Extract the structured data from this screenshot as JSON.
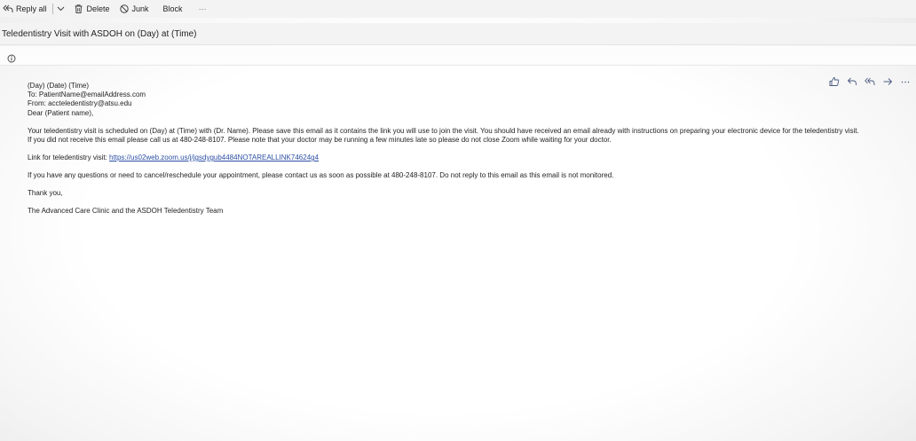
{
  "toolbar": {
    "reply_all_label": "Reply all",
    "delete_label": "Delete",
    "junk_label": "Junk",
    "block_label": "Block",
    "more_label": "···"
  },
  "subject": "Teledentistry Visit with ASDOH on (Day) at (Time)",
  "icons": {
    "reply_all": "reply-all-icon",
    "chevron": "chevron-down-icon",
    "delete": "trash-icon",
    "junk": "block-circle-icon",
    "info": "info-icon",
    "like": "thumbs-up-icon",
    "reply": "reply-icon",
    "forward": "forward-arrow-icon",
    "more": "more-dots-icon"
  },
  "email": {
    "date_line": "(Day) (Date) (Time)",
    "to_line": "To: PatientName@emailAddress.com",
    "from_line": "From: accteledentistry@atsu.edu",
    "greeting": "Dear (Patient name),",
    "para1_line1": "Your teledentistry visit is scheduled on (Day) at (Time) with (Dr. Name). Please save this email as it contains the link you will use to join the visit. You should have received an email already with instructions on preparing your electronic device for the teledentistry visit.",
    "para1_line2": "If you did not receive this email please call us at 480-248-8107. Please note that your doctor may be running a few minutes late so please do not close Zoom while waiting for your doctor.",
    "link_label": "Link for teledentistry visit: ",
    "link_url": "https://us02web.zoom.us/j/jgsdygub4484NOTAREALLINK74624g4",
    "para2": "If you have any questions or need to cancel/reschedule your appointment, please contact us as soon as possible at 480-248-8107. Do not reply to this email as this email is not monitored.",
    "closing": "Thank you,",
    "signature": "The Advanced Care Clinic and the ASDOH Teledentistry Team"
  },
  "colors": {
    "link": "#2a4fa3",
    "toolbar_bg": "#f3f3f3",
    "text": "#242424"
  }
}
